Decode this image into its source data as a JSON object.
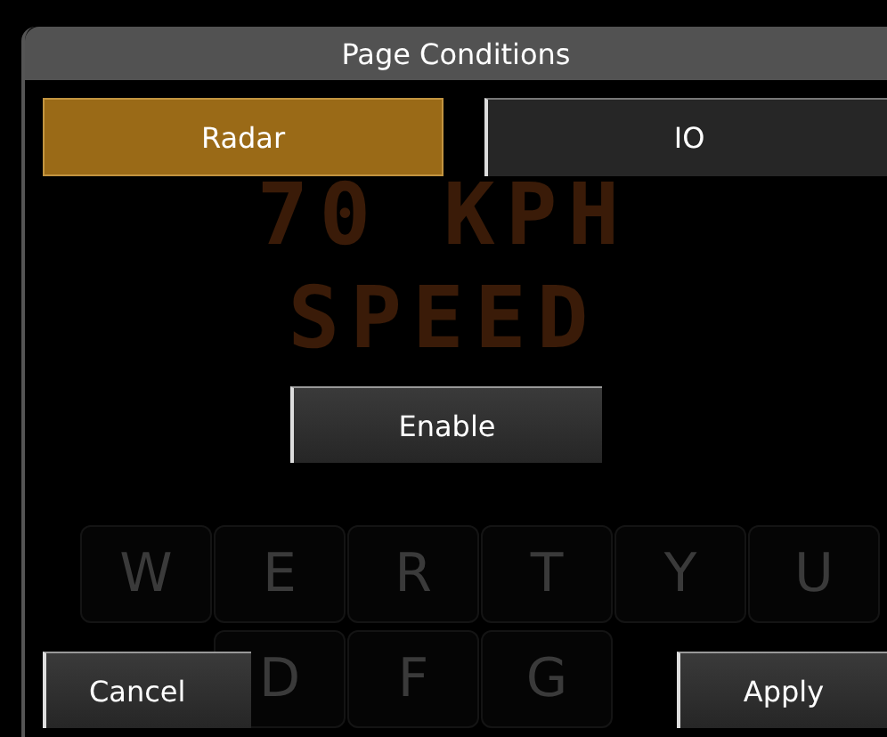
{
  "dialog": {
    "title": "Page Conditions",
    "tabs": [
      {
        "label": "Radar",
        "selected": true
      },
      {
        "label": "IO",
        "selected": false
      }
    ],
    "enable_button": "Enable",
    "cancel_button": "Cancel",
    "apply_button": "Apply"
  },
  "background": {
    "sign_lines": [
      "70 KPH",
      "SPEED"
    ],
    "keyboard_rows": [
      {
        "keys": [
          "W",
          "E",
          "R",
          "T",
          "Y",
          "U"
        ]
      },
      {
        "keys": [
          "D",
          "F",
          "G"
        ]
      }
    ]
  }
}
